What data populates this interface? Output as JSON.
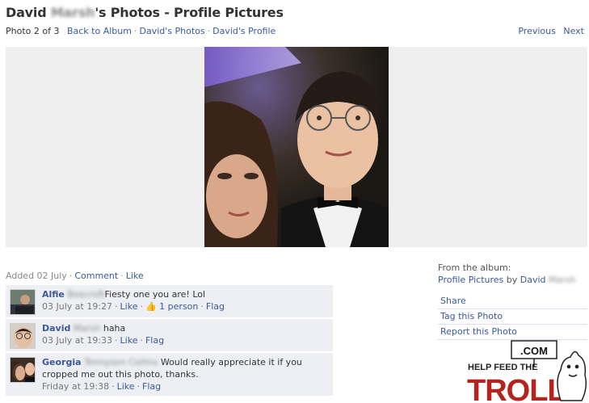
{
  "header": {
    "title_first": "David",
    "title_blurred": "Marsh",
    "title_rest": "'s Photos - Profile Pictures"
  },
  "subnav": {
    "photo_count": "Photo 2 of 3",
    "back_to_album": "Back to Album",
    "davids_photos": "David's Photos",
    "davids_profile": "David's Profile",
    "separator": "·"
  },
  "pager": {
    "previous": "Previous",
    "next": "Next"
  },
  "photo_meta": {
    "added": "Added 02 July",
    "comment": "Comment",
    "like": "Like"
  },
  "comments": [
    {
      "name": "Alfie",
      "name_blurred": "Beecroft",
      "text": "Fiesty one you are! Lol",
      "time": "03 July at 19:27",
      "like": "Like",
      "likes": "1 person",
      "flag": "Flag"
    },
    {
      "name": "David",
      "name_blurred": "Marsh",
      "text": "haha",
      "time": "03 July at 19:33",
      "like": "Like",
      "flag": "Flag"
    },
    {
      "name": "Georgia",
      "name_blurred": "Tennyson Collins",
      "text": "Would really appreciate it if you cropped me out this photo, thanks.",
      "time": "Friday at 19:38",
      "like": "Like",
      "flag": "Flag"
    }
  ],
  "sidebar": {
    "from_album": "From the album:",
    "album_name": "Profile Pictures",
    "by": "by",
    "owner": "David",
    "owner_blurred": "Marsh",
    "actions": [
      "Share",
      "Tag this Photo",
      "Report this Photo"
    ]
  },
  "watermark": {
    "com": ".COM",
    "line1": "HELP FEED THE",
    "line2": "TROLL"
  },
  "colors": {
    "link": "#3b5998",
    "comment_bg": "#edeff4",
    "stage_bg": "#efefef",
    "troll_red": "#b5231e"
  }
}
